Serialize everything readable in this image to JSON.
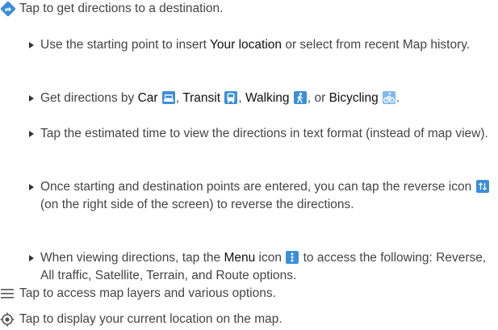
{
  "items": {
    "directions": {
      "icon": "directions-icon",
      "text": "Tap to get directions to a destination."
    },
    "layers": {
      "icon": "menu-lines-icon",
      "text": "Tap to access map layers and various options."
    },
    "location": {
      "icon": "my-location-icon",
      "text": "Tap to display your current location on the map."
    }
  },
  "bullets": {
    "b1": {
      "t1": "Use the starting point to insert ",
      "key": "Your location",
      "t2": " or select from recent Map history."
    },
    "b2": {
      "t1": "Get directions by ",
      "car": "Car",
      "sep1": ", ",
      "transit": "Transit",
      "sep2": ", ",
      "walking": "Walking",
      "sep3": ", or ",
      "bicycling": "Bicycling",
      "end": "."
    },
    "b3": {
      "text": "Tap the estimated time to view the directions in text format (instead of map view)."
    },
    "b4": {
      "t1": "Once starting and destination points are entered, you can tap the reverse icon ",
      "t2": " (on the right side of the screen) to reverse the directions."
    },
    "b5": {
      "t1": "When viewing directions, tap the ",
      "key": "Menu",
      "t2": " icon ",
      "t3": " to access the following: Reverse, All traffic, Satellite, Terrain, and Route options."
    }
  },
  "colors": {
    "icon_blue": "#3b8fd9",
    "text": "#444444",
    "key_text": "#111111"
  }
}
